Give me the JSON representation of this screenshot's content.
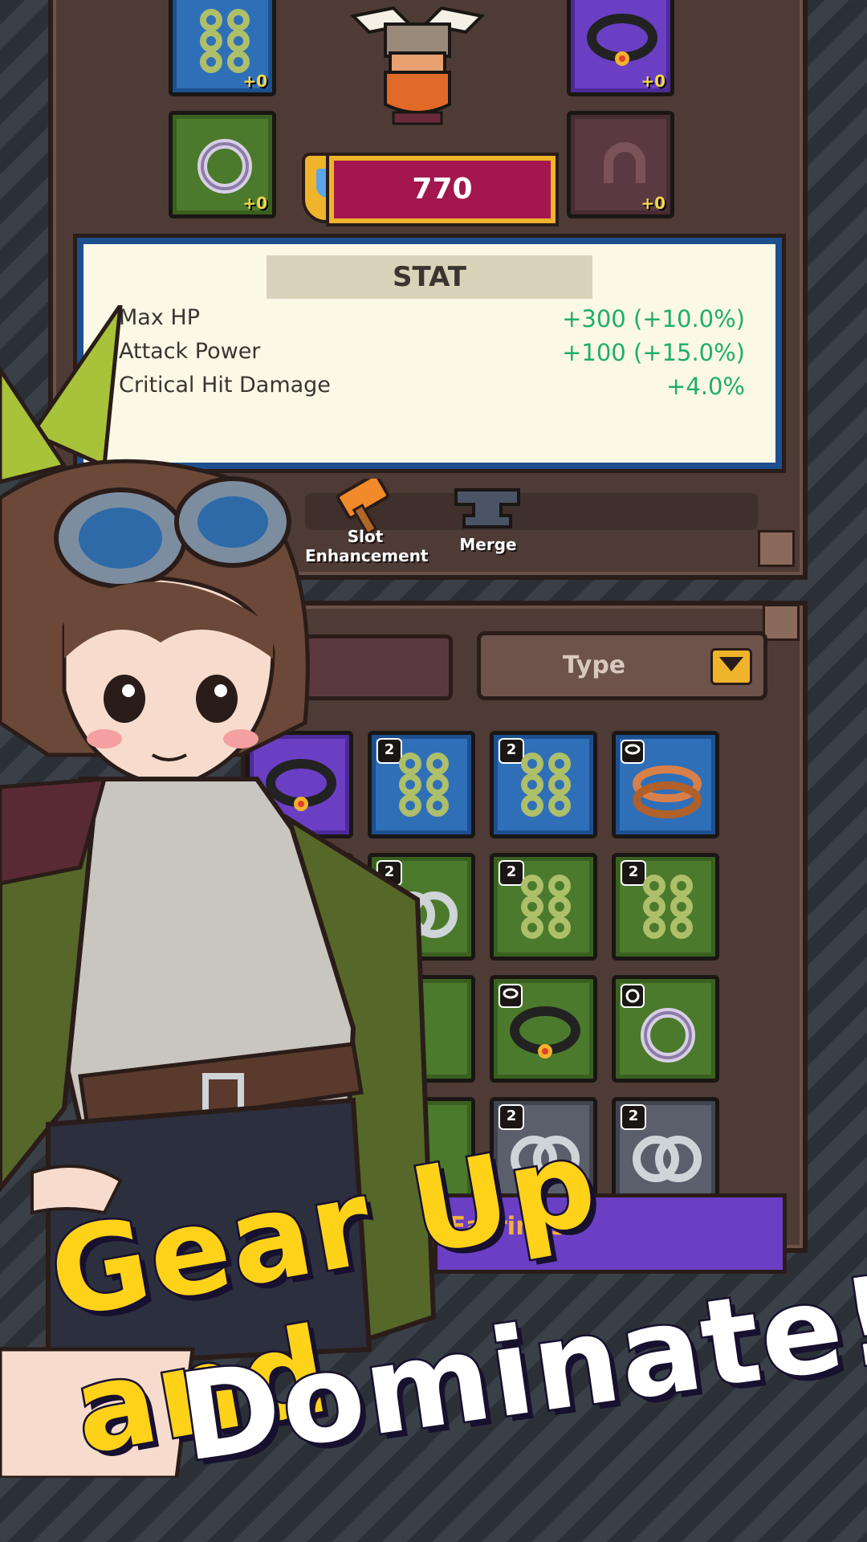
{
  "power": {
    "value": "770"
  },
  "stat": {
    "title": "STAT",
    "rows": [
      {
        "name": "Max HP",
        "value": "+300 (+10.0%)"
      },
      {
        "name": "Attack Power",
        "value": "+100 (+15.0%)"
      },
      {
        "name": "Critical Hit Damage",
        "value": "+4.0%"
      }
    ]
  },
  "equipped": {
    "left_top_level": "+0",
    "left_bottom_level": "+0",
    "right_top_level": "+0",
    "right_bottom_level": "+0"
  },
  "actions": {
    "slot_enhancement": "Slot\nEnhancement",
    "merge": "Merge"
  },
  "filter": {
    "type_label": "Type"
  },
  "inventory": {
    "badge": "2"
  },
  "tooltip": {
    "label": "Earrings"
  },
  "headline": {
    "line1": "Gear Up and",
    "line2": "Dominate!!"
  },
  "colors": {
    "rarity_blue": "#2f6fb8",
    "rarity_purple": "#6b3fc4",
    "rarity_green": "#4c7a2c",
    "rarity_gray": "#5a5f6b",
    "stat_value": "#1fae6a",
    "headline_yellow": "#ffd21a"
  }
}
